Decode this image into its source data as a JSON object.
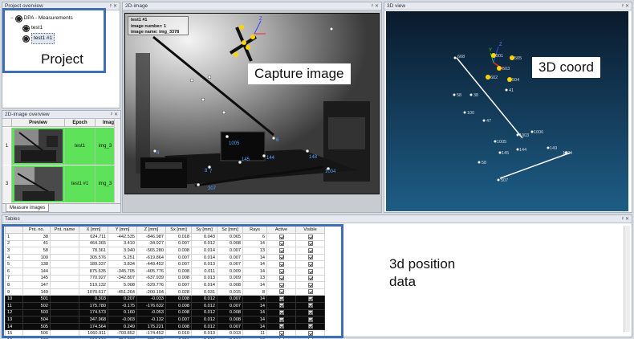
{
  "project_overview": {
    "title": "Project overview",
    "root": "DPA - Measurements",
    "items": [
      "test1",
      "test1 #1"
    ],
    "annotation": "Project"
  },
  "image_overview": {
    "title": "2D-image overview",
    "columns": [
      "Preview",
      "Epoch",
      "Imag"
    ],
    "rows": [
      {
        "index": "1",
        "epoch": "test1",
        "image": "img_3"
      },
      {
        "index": "3",
        "epoch": "test1 #1",
        "image": "img_3"
      }
    ],
    "tab": "Measure images"
  },
  "image_view": {
    "title": "2D-image",
    "info_lines": [
      "test1 #1",
      "image number: 1",
      "image name:   img_3378"
    ],
    "axis_label": "Z",
    "annotation": "Capture image",
    "point_labels": [
      "1005",
      "145",
      "144",
      "6",
      "148",
      "1004",
      "7",
      "8",
      "307",
      "4"
    ]
  },
  "view3d": {
    "title": "3D view",
    "axis_labels": [
      "Z",
      "Y"
    ],
    "annotation": "3D coord",
    "point_labels": [
      "608",
      "501",
      "505",
      "503",
      "602",
      "504",
      "41",
      "58",
      "38",
      "100",
      "47",
      "1003",
      "1006",
      "1005",
      "144",
      "145",
      "149",
      "1004",
      "58",
      "507"
    ]
  },
  "tables": {
    "title": "Tables",
    "annotation": "3d position data",
    "columns": [
      "",
      "Pnt. no.",
      "Pnt. name",
      "X [mm]",
      "Y [mm]",
      "Z [mm]",
      "Sx [mm]",
      "Sy [mm]",
      "Sz [mm]",
      "Rays",
      "Active",
      "Visible"
    ],
    "rows": [
      [
        "1",
        "38",
        "",
        "624.711",
        "-442.535",
        "-846.987",
        "0.018",
        "0.043",
        "0.065",
        "6"
      ],
      [
        "2",
        "41",
        "",
        "464.365",
        "3.410",
        "-34.927",
        "0.007",
        "0.012",
        "0.008",
        "14"
      ],
      [
        "3",
        "58",
        "",
        "78.361",
        "3.940",
        "-565.280",
        "0.008",
        "0.014",
        "0.007",
        "13"
      ],
      [
        "4",
        "100",
        "",
        "305.576",
        "5.251",
        "-619.864",
        "0.007",
        "0.014",
        "0.007",
        "14"
      ],
      [
        "5",
        "138",
        "",
        "189.337",
        "3.834",
        "-449.452",
        "0.007",
        "0.013",
        "0.007",
        "14"
      ],
      [
        "6",
        "144",
        "",
        "875.635",
        "-345.705",
        "-405.776",
        "0.008",
        "0.011",
        "0.009",
        "14"
      ],
      [
        "7",
        "145",
        "",
        "770.927",
        "-342.807",
        "-637.939",
        "0.008",
        "0.013",
        "0.009",
        "13"
      ],
      [
        "8",
        "147",
        "",
        "519.132",
        "5.008",
        "-529.776",
        "0.007",
        "0.014",
        "0.008",
        "14"
      ],
      [
        "9",
        "149",
        "",
        "1070.617",
        "-451.264",
        "-200.104",
        "0.028",
        "0.031",
        "0.015",
        "8"
      ],
      [
        "10",
        "501",
        "",
        "0.303",
        "0.207",
        "-0.033",
        "0.008",
        "0.012",
        "0.007",
        "14"
      ],
      [
        "11",
        "502",
        "",
        "175.780",
        "-0.175",
        "-176.632",
        "0.008",
        "0.012",
        "0.007",
        "14"
      ],
      [
        "12",
        "503",
        "",
        "174.573",
        "0.160",
        "-0.053",
        "0.008",
        "0.012",
        "0.008",
        "14"
      ],
      [
        "13",
        "504",
        "",
        "347.968",
        "-0.003",
        "-0.132",
        "0.007",
        "0.012",
        "0.008",
        "14"
      ],
      [
        "14",
        "505",
        "",
        "174.564",
        "0.249",
        "175.221",
        "0.008",
        "0.012",
        "0.007",
        "14"
      ],
      [
        "15",
        "506",
        "",
        "1060.911",
        "-703.852",
        "-174.452",
        "0.010",
        "0.013",
        "0.013",
        "11"
      ],
      [
        "16",
        "507",
        "",
        "613.618",
        "-724.093",
        "-825.096",
        "0.011",
        "0.019",
        "0.014",
        "10"
      ]
    ],
    "dark_rows": [
      10,
      11,
      12,
      13,
      14
    ]
  },
  "colors": {
    "highlight": "#3e6fb6",
    "view3d_top": "#0a1a2c",
    "view3d_bottom": "#1d5d86",
    "row_green": "#5ee25a"
  }
}
